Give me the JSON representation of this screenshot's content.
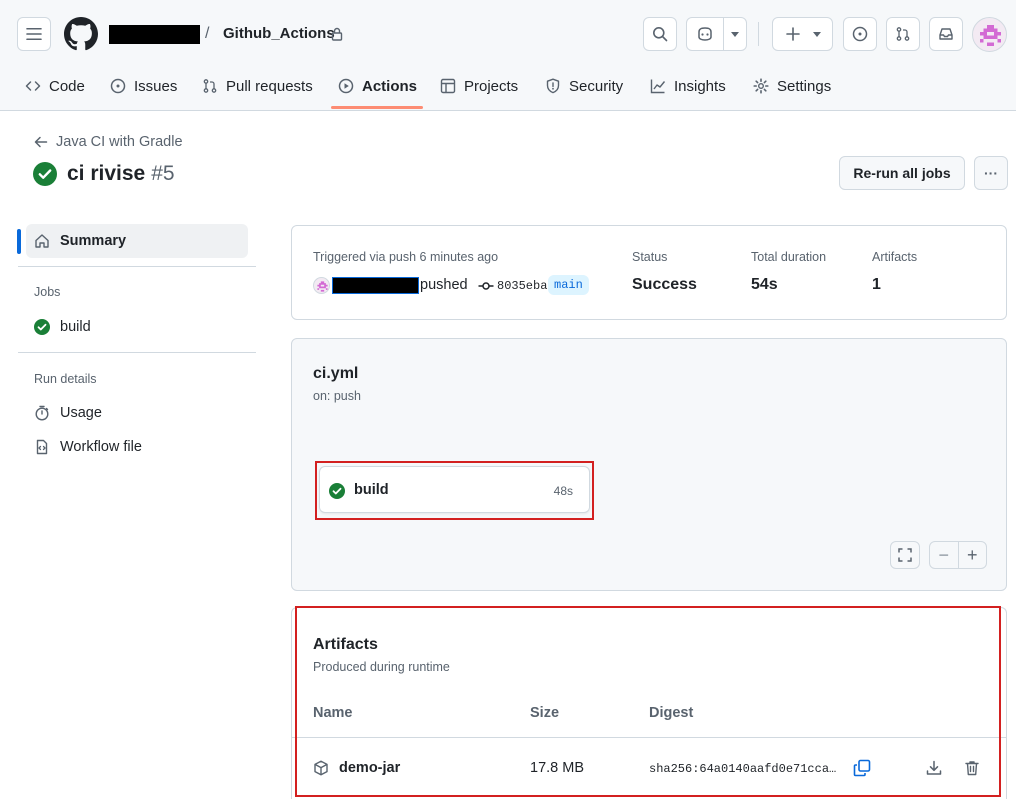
{
  "repo": {
    "name": "Github_Actions",
    "separator": "/"
  },
  "tabs": [
    {
      "label": "Code"
    },
    {
      "label": "Issues"
    },
    {
      "label": "Pull requests"
    },
    {
      "label": "Actions"
    },
    {
      "label": "Projects"
    },
    {
      "label": "Security"
    },
    {
      "label": "Insights"
    },
    {
      "label": "Settings"
    }
  ],
  "run": {
    "back_label": "Java CI with Gradle",
    "title": "ci rivise",
    "number": "#5",
    "rerun_label": "Re-run all jobs",
    "more_label": "···"
  },
  "sidebar": {
    "summary_label": "Summary",
    "jobs_heading": "Jobs",
    "job_label": "build",
    "run_details_heading": "Run details",
    "usage_label": "Usage",
    "workflow_file_label": "Workflow file"
  },
  "summary": {
    "trigger_text": "Triggered via push 6 minutes ago",
    "pushed_text": "pushed",
    "commit": "8035eba",
    "branch": "main",
    "status_label": "Status",
    "status_value": "Success",
    "duration_label": "Total duration",
    "duration_value": "54s",
    "artifacts_label": "Artifacts",
    "artifacts_value": "1"
  },
  "workflow": {
    "file": "ci.yml",
    "trigger": "on: push",
    "job_name": "build",
    "job_duration": "48s",
    "zoom_out": "−",
    "zoom_in": "+"
  },
  "artifacts": {
    "title": "Artifacts",
    "subtitle": "Produced during runtime",
    "columns": {
      "name": "Name",
      "size": "Size",
      "digest": "Digest"
    },
    "rows": [
      {
        "name": "demo-jar",
        "size": "17.8 MB",
        "digest": "sha256:64a0140aafd0e71cca…"
      }
    ]
  },
  "colors": {
    "success": "#1a7f37",
    "accent_underline": "#fd8c73",
    "link_blue": "#0969da",
    "highlight_frame": "#d32020",
    "redaction": "#000000"
  },
  "icons": {
    "menu": "hamburger-icon",
    "logo": "github-mark-icon",
    "lock": "lock-icon",
    "search": "search-icon",
    "copilot": "copilot-icon",
    "plus": "plus-icon",
    "issues": "issue-circle-icon",
    "pulls": "git-pull-request-icon",
    "inbox": "inbox-icon",
    "package": "package-icon",
    "copy": "copy-icon",
    "download": "download-icon",
    "trash": "trash-icon"
  }
}
